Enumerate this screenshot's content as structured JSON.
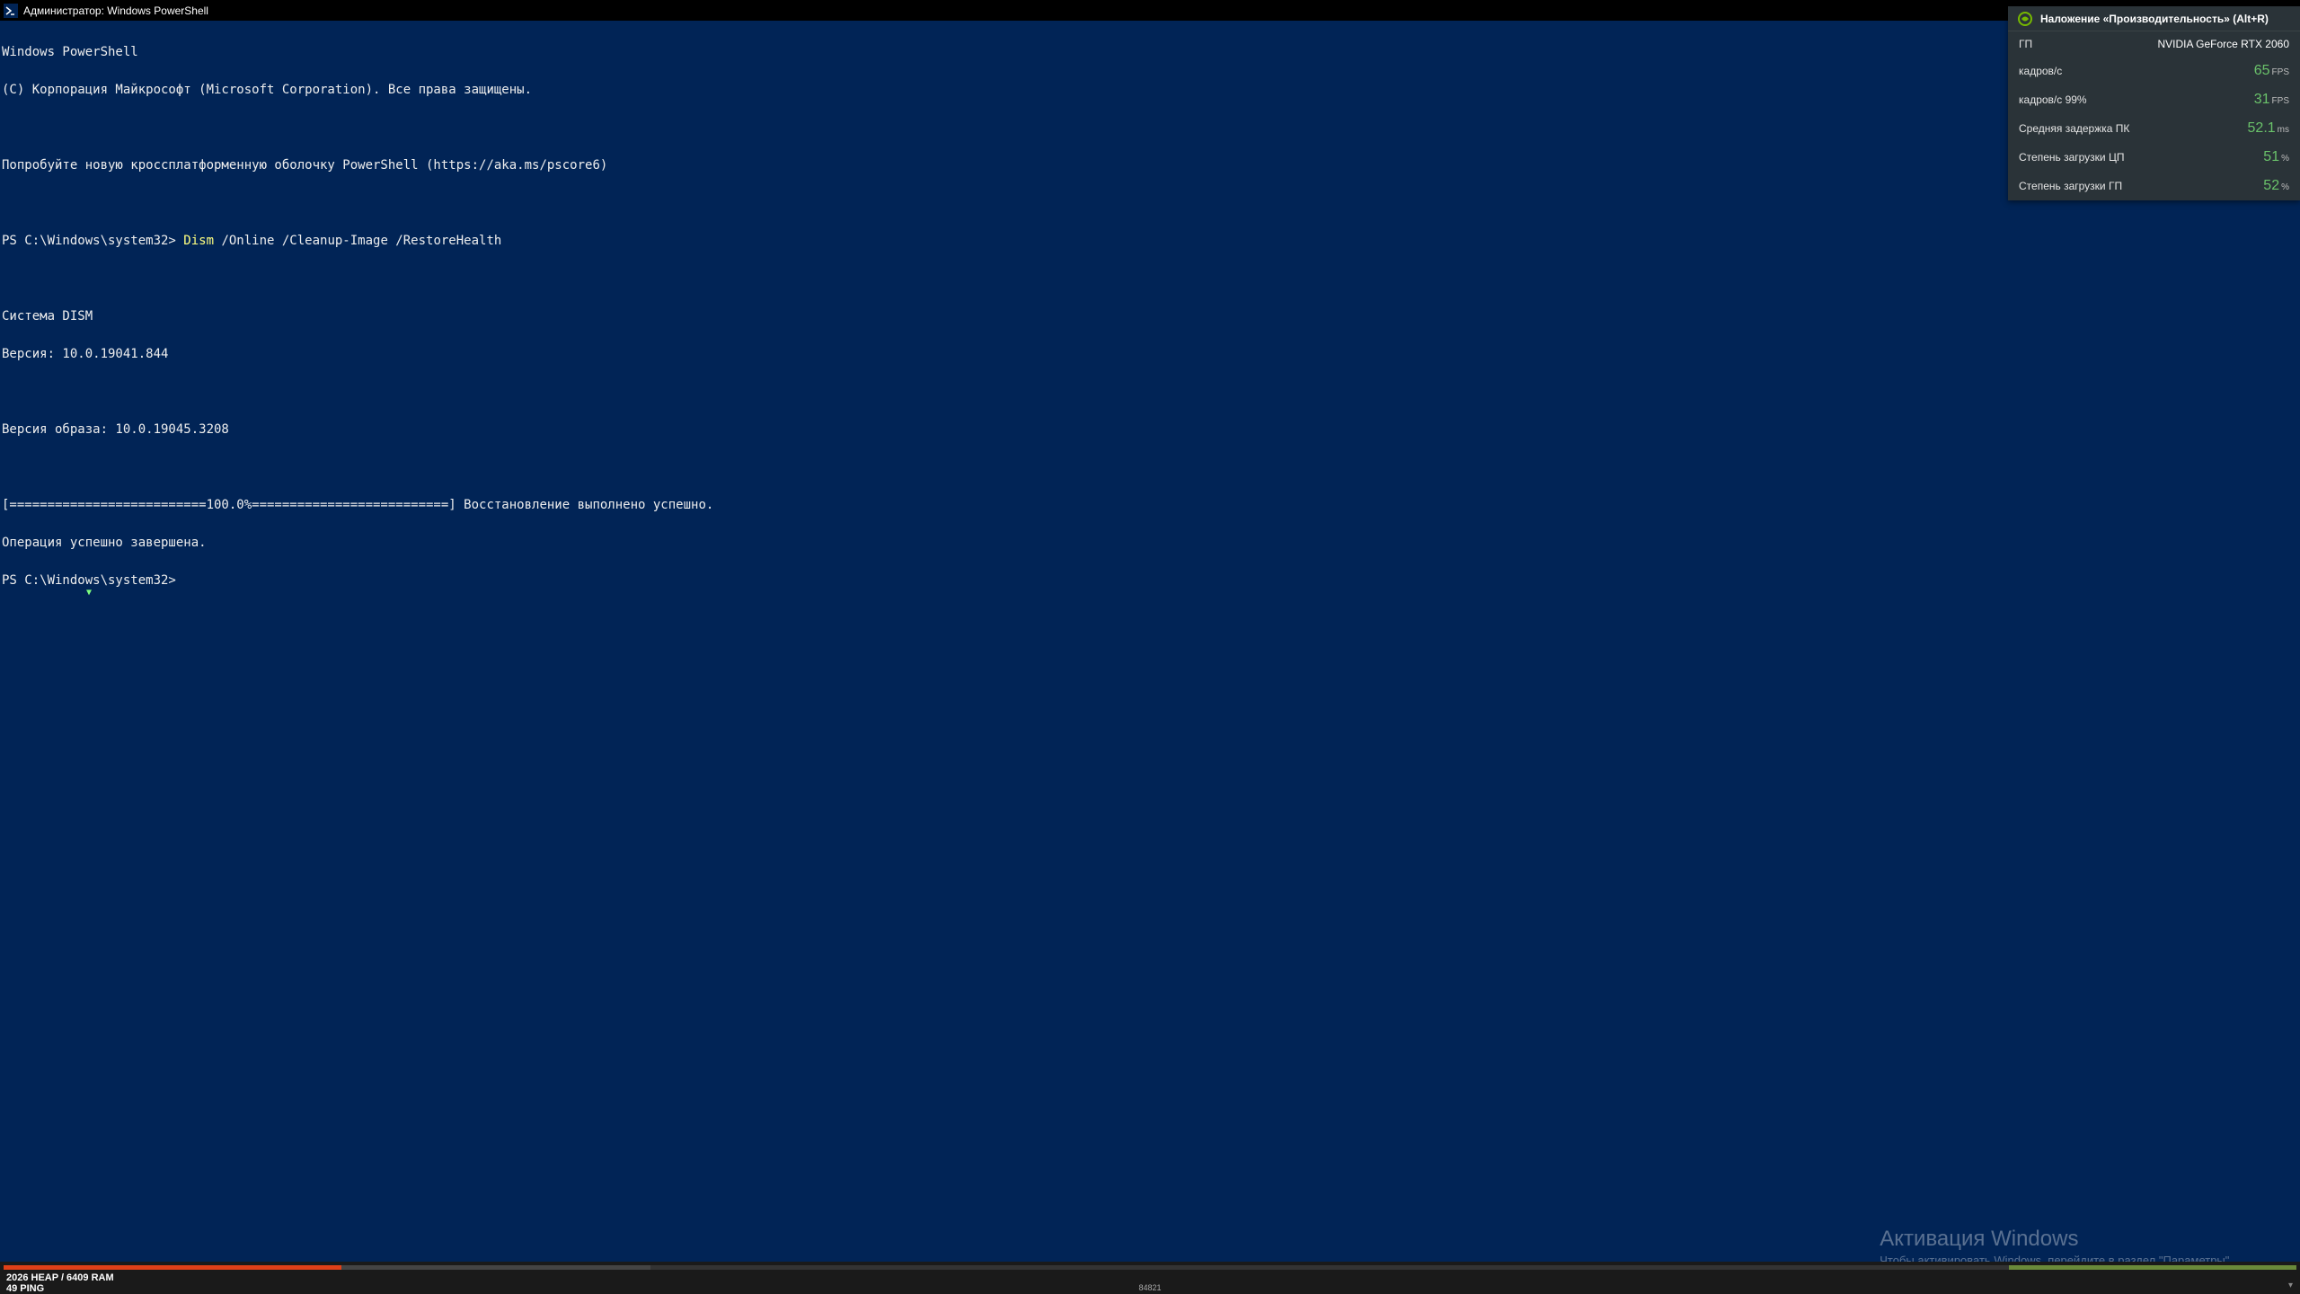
{
  "titlebar": {
    "title": "Администратор: Windows PowerShell"
  },
  "terminal": {
    "l1": "Windows PowerShell",
    "l2": "(C) Корпорация Майкрософт (Microsoft Corporation). Все права защищены.",
    "l3": "Попробуйте новую кроссплатформенную оболочку PowerShell (https://aka.ms/pscore6)",
    "prompt1": "PS C:\\Windows\\system32> ",
    "cmd1a": "Dism",
    "cmd1b": " /Online /Cleanup-Image /RestoreHealth",
    "l5": "Система DISM",
    "l6": "Версия: 10.0.19041.844",
    "l7": "Версия образа: 10.0.19045.3208",
    "l8": "[==========================100.0%==========================] Восстановление выполнено успешно.",
    "l9": "Операция успешно завершена.",
    "prompt2": "PS C:\\Windows\\system32>"
  },
  "watermark": {
    "title": "Активация Windows",
    "sub": "Чтобы активировать Windows, перейдите в раздел \"Параметры\"."
  },
  "overlay": {
    "header": "Наложение «Производительность» (Alt+R)",
    "gpu_label": "ГП",
    "gpu_name": "NVIDIA GeForce RTX 2060",
    "rows": [
      {
        "label": "кадров/с",
        "value": "65",
        "unit": "FPS"
      },
      {
        "label": "кадров/с 99%",
        "value": "31",
        "unit": "FPS"
      },
      {
        "label": "Средняя задержка ПК",
        "value": "52.1",
        "unit": "ms"
      },
      {
        "label": "Степень загрузки ЦП",
        "value": "51",
        "unit": "%"
      },
      {
        "label": "Степень загрузки ГП",
        "value": "52",
        "unit": "%"
      }
    ]
  },
  "bottombar": {
    "text1": "2026 HEAP / 6409 RAM",
    "text2": "49 PING",
    "center": "84821"
  }
}
